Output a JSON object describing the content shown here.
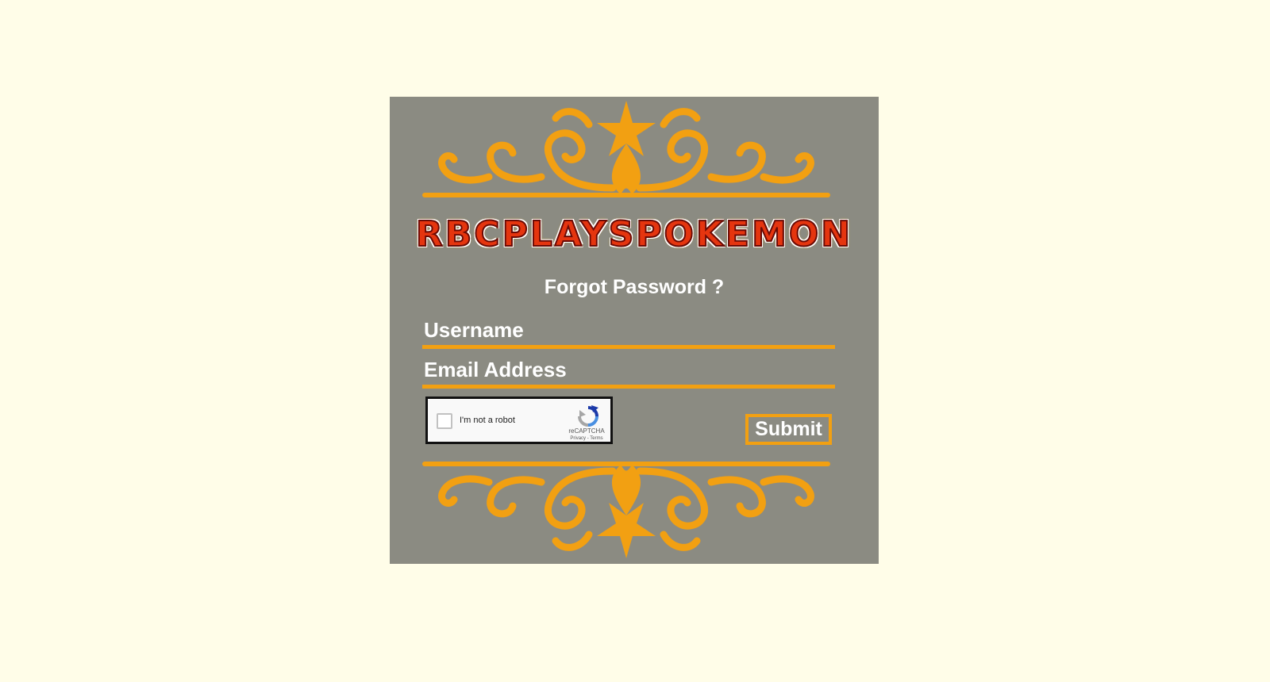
{
  "logo": {
    "text": "RBCPLAYSPOKEMON"
  },
  "form": {
    "title": "Forgot Password ?",
    "username_placeholder": "Username",
    "email_placeholder": "Email Address",
    "submit_label": "Submit"
  },
  "captcha": {
    "label": "I'm not a robot",
    "brand": "reCAPTCHA",
    "links": "Privacy - Terms"
  },
  "colors": {
    "page_background": "#fffde8",
    "panel_background": "#8b8b82",
    "accent": "#f2a012",
    "text": "#ffffff",
    "logo_fill": "#e5350f"
  },
  "icons": {
    "ornament_top": "ornamental-flourish-icon",
    "ornament_bottom": "ornamental-flourish-icon",
    "captcha": "recaptcha-icon"
  }
}
